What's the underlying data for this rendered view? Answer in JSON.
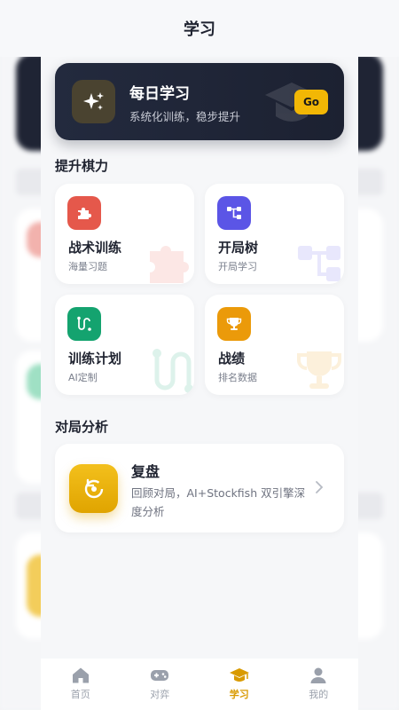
{
  "header": {
    "title": "学习"
  },
  "hero": {
    "title": "每日学习",
    "subtitle": "系统化训练，稳步提升",
    "go_label": "Go"
  },
  "sections": {
    "improve": "提升棋力",
    "analysis": "对局分析"
  },
  "cards": [
    {
      "name": "战术训练",
      "sub": "海量习题",
      "icon": "puzzle-icon",
      "color": "#e5584b"
    },
    {
      "name": "开局树",
      "sub": "开局学习",
      "icon": "tree-icon",
      "color": "#5b55e6"
    },
    {
      "name": "训练计划",
      "sub": "AI定制",
      "icon": "route-icon",
      "color": "#14a36f"
    },
    {
      "name": "战绩",
      "sub": "排名数据",
      "icon": "trophy-icon",
      "color": "#eb9a0a"
    }
  ],
  "review": {
    "name": "复盘",
    "desc": "回顾对局，AI+Stockfish 双引擎深度分析",
    "icon": "replay-icon"
  },
  "tabs": [
    {
      "label": "首页",
      "icon": "home-icon"
    },
    {
      "label": "对弈",
      "icon": "gamepad-icon"
    },
    {
      "label": "学习",
      "icon": "graduation-cap-icon",
      "active": true
    },
    {
      "label": "我的",
      "icon": "user-icon"
    }
  ],
  "colors": {
    "accent": "#f2b705",
    "dark": "#1f2434"
  }
}
